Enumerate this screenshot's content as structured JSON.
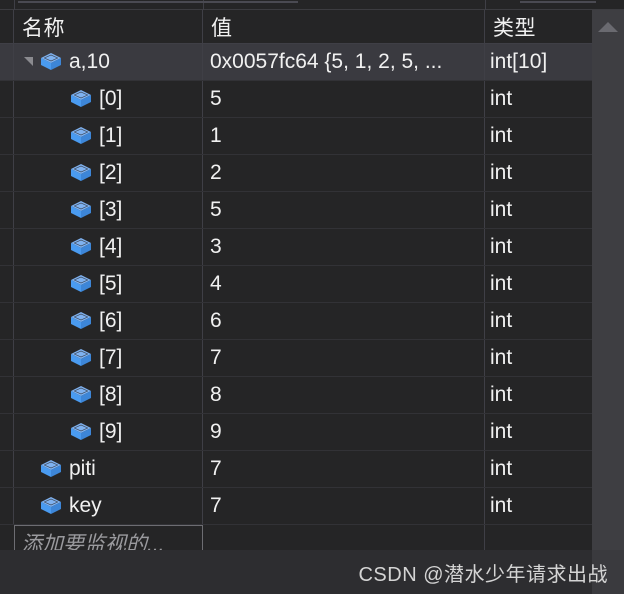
{
  "window": {
    "type": "debugger-watch-window",
    "theme_background": "#252526",
    "accent_changed_value": "#e28b80"
  },
  "columns": {
    "name": "名称",
    "value": "值",
    "type": "类型"
  },
  "rows": [
    {
      "icon": "cube-icon",
      "level": 0,
      "expander": "expanded",
      "name": "a,10",
      "value": "0x0057fc64 {5, 1, 2, 5, ...",
      "type": "int[10]",
      "value_changed": true,
      "selected": true
    },
    {
      "icon": "cube-icon",
      "level": 1,
      "name": "[0]",
      "value": "5",
      "type": "int",
      "value_changed": false,
      "selected": false
    },
    {
      "icon": "cube-icon",
      "level": 1,
      "name": "[1]",
      "value": "1",
      "type": "int",
      "value_changed": false,
      "selected": false
    },
    {
      "icon": "cube-icon",
      "level": 1,
      "name": "[2]",
      "value": "2",
      "type": "int",
      "value_changed": false,
      "selected": false
    },
    {
      "icon": "cube-icon",
      "level": 1,
      "name": "[3]",
      "value": "5",
      "type": "int",
      "value_changed": false,
      "selected": false
    },
    {
      "icon": "cube-icon",
      "level": 1,
      "name": "[4]",
      "value": "3",
      "type": "int",
      "value_changed": false,
      "selected": false
    },
    {
      "icon": "cube-icon",
      "level": 1,
      "name": "[5]",
      "value": "4",
      "type": "int",
      "value_changed": false,
      "selected": false
    },
    {
      "icon": "cube-icon",
      "level": 1,
      "name": "[6]",
      "value": "6",
      "type": "int",
      "value_changed": false,
      "selected": false
    },
    {
      "icon": "cube-icon",
      "level": 1,
      "name": "[7]",
      "value": "7",
      "type": "int",
      "value_changed": true,
      "selected": false
    },
    {
      "icon": "cube-icon",
      "level": 1,
      "name": "[8]",
      "value": "8",
      "type": "int",
      "value_changed": false,
      "selected": false
    },
    {
      "icon": "cube-icon",
      "level": 1,
      "name": "[9]",
      "value": "9",
      "type": "int",
      "value_changed": false,
      "selected": false
    },
    {
      "icon": "cube-icon",
      "level": 0,
      "name": "piti",
      "value": "7",
      "type": "int",
      "value_changed": false,
      "selected": false
    },
    {
      "icon": "cube-icon",
      "level": 0,
      "name": "key",
      "value": "7",
      "type": "int",
      "value_changed": false,
      "selected": false
    }
  ],
  "add_watch": {
    "placeholder": "添加要监视的..."
  },
  "scrollbar": {
    "up_arrow_icon": "chevron-up-icon"
  },
  "watermark": {
    "text": "CSDN @潜水少年请求出战"
  }
}
